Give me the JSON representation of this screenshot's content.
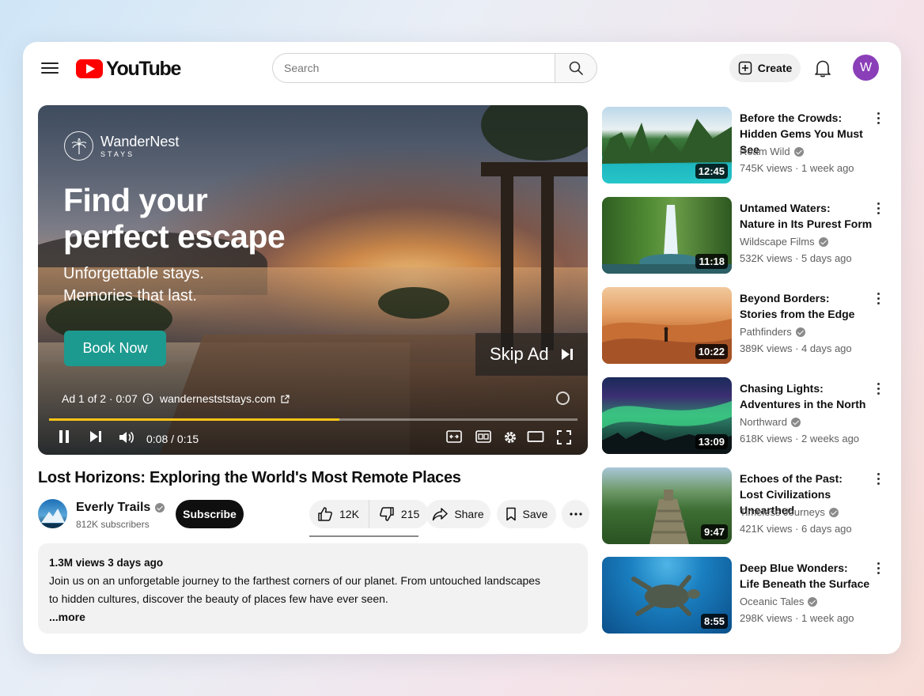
{
  "header": {
    "logo_text": "YouTube",
    "search_placeholder": "Search",
    "create_label": "Create",
    "user_initial": "W"
  },
  "player": {
    "brand_name": "WanderNest",
    "brand_sub": "STAYS",
    "ad_title_line1": "Find your",
    "ad_title_line2": "perfect escape",
    "ad_sub_line1": "Unforgettable stays.",
    "ad_sub_line2": "Memories that last.",
    "book_label": "Book Now",
    "skip_label": "Skip Ad",
    "ad_info": "Ad 1 of 2 · 0:07",
    "ad_url": "wandernestststays.com",
    "time": "0:08 / 0:15",
    "progress": 0.55
  },
  "video": {
    "title": "Lost Horizons: Exploring the World's Most Remote Places",
    "channel": "Everly Trails",
    "subscribers": "812K subscribers",
    "subscribe_label": "Subscribe",
    "likes": "12K",
    "dislikes": "215",
    "share_label": "Share",
    "save_label": "Save",
    "views_date": "1.3M views  3 days ago",
    "description_line1": "Join us on an unforgetable journey to the farthest corners of our planet. From untouched landscapes",
    "description_line2": "to hidden cultures, discover the beauty of places few have ever seen.",
    "more_label": "...more"
  },
  "recommendations": [
    {
      "title_line1": "Before the Crowds:",
      "title_line2": "Hidden Gems You Must See",
      "channel": "Roam Wild",
      "meta": "745K views · 1 week ago",
      "duration": "12:45"
    },
    {
      "title_line1": "Untamed Waters:",
      "title_line2": "Nature in Its Purest Form",
      "channel": "Wildscape Films",
      "meta": "532K views · 5 days ago",
      "duration": "11:18"
    },
    {
      "title_line1": "Beyond Borders:",
      "title_line2": "Stories from the Edge",
      "channel": "Pathfinders",
      "meta": "389K views · 4 days ago",
      "duration": "10:22"
    },
    {
      "title_line1": "Chasing Lights:",
      "title_line2": "Adventures in the North",
      "channel": "Northward",
      "meta": "618K views · 2 weeks ago",
      "duration": "13:09"
    },
    {
      "title_line1": "Echoes of the Past:",
      "title_line2": "Lost Civilizations Unearthed",
      "channel": "Timeless Journeys",
      "meta": "421K views · 6 days ago",
      "duration": "9:47"
    },
    {
      "title_line1": "Deep Blue Wonders:",
      "title_line2": "Life Beneath the Surface",
      "channel": "Oceanic Tales",
      "meta": "298K views · 1 week ago",
      "duration": "8:55"
    }
  ],
  "colors": {
    "accent_red": "#ff0000",
    "book_button": "#1d9a8f",
    "progress": "#fcc419",
    "avatar": "#8a3fb8"
  }
}
